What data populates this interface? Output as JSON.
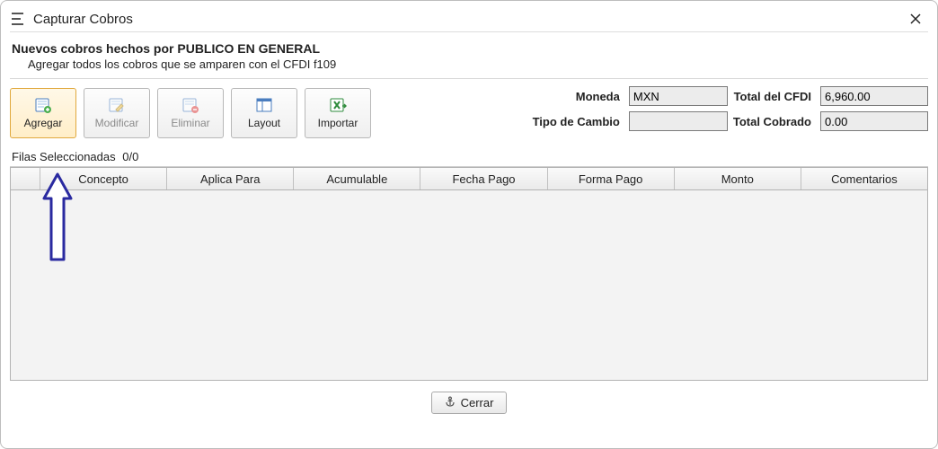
{
  "window": {
    "title": "Capturar Cobros",
    "subtitle_bold": "Nuevos cobros hechos por PUBLICO EN GENERAL",
    "subtitle_desc": "Agregar todos los cobros que se amparen con el CFDI f109"
  },
  "toolbar": {
    "agregar": "Agregar",
    "modificar": "Modificar",
    "eliminar": "Eliminar",
    "layout": "Layout",
    "importar": "Importar"
  },
  "fields": {
    "moneda_label": "Moneda",
    "moneda_value": "MXN",
    "total_cfdi_label": "Total del CFDI",
    "total_cfdi_value": "6,960.00",
    "tipo_cambio_label": "Tipo de Cambio",
    "tipo_cambio_value": "",
    "total_cobrado_label": "Total Cobrado",
    "total_cobrado_value": "0.00"
  },
  "table": {
    "rows_selected_label": "Filas Seleccionadas",
    "rows_selected_count": "0/0",
    "columns": [
      "Concepto",
      "Aplica Para",
      "Acumulable",
      "Fecha Pago",
      "Forma Pago",
      "Monto",
      "Comentarios"
    ]
  },
  "footer": {
    "close_label": "Cerrar"
  }
}
